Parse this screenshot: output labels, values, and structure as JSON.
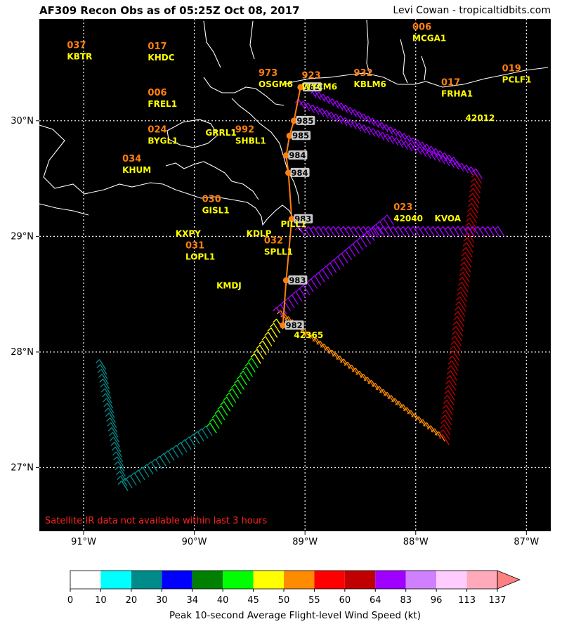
{
  "header": {
    "title": "AF309 Recon Obs as of 05:25Z Oct 08, 2017",
    "credit": "Levi Cowan - tropicaltidbits.com"
  },
  "map": {
    "extent": {
      "lon": [
        -91.4,
        -86.78
      ],
      "lat": [
        26.45,
        30.88
      ]
    },
    "lon_ticks": [
      {
        "value": -91,
        "label": "91°W"
      },
      {
        "value": -90,
        "label": "90°W"
      },
      {
        "value": -89,
        "label": "89°W"
      },
      {
        "value": -88,
        "label": "88°W"
      },
      {
        "value": -87,
        "label": "87°W"
      }
    ],
    "lat_ticks": [
      {
        "value": 27,
        "label": "27°N"
      },
      {
        "value": 28,
        "label": "28°N"
      },
      {
        "value": 29,
        "label": "29°N"
      },
      {
        "value": 30,
        "label": "30°N"
      }
    ],
    "background": "#000000",
    "grid": true,
    "note": "Satellite IR data not available within last 3 hours",
    "stations": [
      {
        "id": "KBTR",
        "value": "037",
        "lon": -91.15,
        "lat": 30.53
      },
      {
        "id": "KHDC",
        "value": "017",
        "lon": -90.42,
        "lat": 30.52
      },
      {
        "id": "FREL1",
        "value": "006",
        "lon": -90.42,
        "lat": 30.12
      },
      {
        "id": "GRRL1",
        "value": "",
        "lon": -89.9,
        "lat": 29.87
      },
      {
        "id": "BYGL1",
        "value": "024",
        "lon": -90.42,
        "lat": 29.8
      },
      {
        "id": "KHUM",
        "value": "034",
        "lon": -90.65,
        "lat": 29.55
      },
      {
        "id": "OSGM6",
        "value": "973",
        "lon": -89.42,
        "lat": 30.29
      },
      {
        "id": "WYCM6",
        "value": "923",
        "lon": -89.03,
        "lat": 30.27
      },
      {
        "id": "KBLM6",
        "value": "932",
        "lon": -88.56,
        "lat": 30.29
      },
      {
        "id": "MCGA1",
        "value": "006",
        "lon": -88.03,
        "lat": 30.69
      },
      {
        "id": "PCLF1",
        "value": "019",
        "lon": -87.22,
        "lat": 30.33
      },
      {
        "id": "FRHA1",
        "value": "017",
        "lon": -87.77,
        "lat": 30.21
      },
      {
        "id": "42012",
        "value": "",
        "lon": -87.55,
        "lat": 30.0
      },
      {
        "id": "SHBL1",
        "value": "992",
        "lon": -89.63,
        "lat": 29.8
      },
      {
        "id": "GISL1",
        "value": "030",
        "lon": -89.93,
        "lat": 29.2
      },
      {
        "id": "PILL1",
        "value": "",
        "lon": -89.22,
        "lat": 29.08
      },
      {
        "id": "KXPY",
        "value": "",
        "lon": -90.17,
        "lat": 29.0
      },
      {
        "id": "KDLP",
        "value": "",
        "lon": -89.53,
        "lat": 29.0
      },
      {
        "id": "LOPL1",
        "value": "031",
        "lon": -90.08,
        "lat": 28.8
      },
      {
        "id": "SPLL1",
        "value": "032",
        "lon": -89.37,
        "lat": 28.84
      },
      {
        "id": "KMDJ",
        "value": "",
        "lon": -89.8,
        "lat": 28.55
      },
      {
        "id": "42040",
        "value": "023",
        "lon": -88.2,
        "lat": 29.13
      },
      {
        "id": "KVOA",
        "value": "",
        "lon": -87.83,
        "lat": 29.13
      },
      {
        "id": "42365",
        "value": "",
        "lon": -89.1,
        "lat": 28.12
      }
    ],
    "center_fixes": [
      {
        "pressure": "985",
        "lon": -89.04,
        "lat": 30.29
      },
      {
        "pressure": "985",
        "lon": -89.1,
        "lat": 30.0
      },
      {
        "pressure": "985",
        "lon": -89.14,
        "lat": 29.87
      },
      {
        "pressure": "984",
        "lon": -89.17,
        "lat": 29.7
      },
      {
        "pressure": "984",
        "lon": -89.15,
        "lat": 29.55
      },
      {
        "pressure": "983",
        "lon": -89.12,
        "lat": 29.15
      },
      {
        "pressure": "983",
        "lon": -89.17,
        "lat": 28.62
      },
      {
        "pressure": "982",
        "lon": -89.2,
        "lat": 28.23
      }
    ],
    "track_color": "#ff7f0e"
  },
  "colorbar": {
    "title": "Peak 10-second Average Flight-level Wind Speed (kt)",
    "ticks": [
      "0",
      "10",
      "20",
      "30",
      "34",
      "40",
      "45",
      "50",
      "55",
      "60",
      "64",
      "83",
      "96",
      "113",
      "137"
    ],
    "colors": [
      "#ffffff",
      "#00ffff",
      "#008b8b",
      "#0000ff",
      "#008000",
      "#00ff00",
      "#ffff00",
      "#ff8c00",
      "#ff0000",
      "#c00000",
      "#a000ff",
      "#d080ff",
      "#ffccff",
      "#ffaabb"
    ],
    "extend_color": "#ff8080"
  },
  "chart_data": {
    "type": "map",
    "title": "AF309 Recon Obs as of 05:25Z Oct 08, 2017",
    "flight_legs": [
      {
        "from": [
          -90.8,
          27.85
        ],
        "to": [
          -90.6,
          26.8
        ],
        "wind_kt": 20
      },
      {
        "from": [
          -90.6,
          26.8
        ],
        "to": [
          -89.8,
          27.3
        ],
        "wind_kt": 20
      },
      {
        "from": [
          -89.8,
          27.3
        ],
        "to": [
          -89.4,
          27.9
        ],
        "wind_kt": 40
      },
      {
        "from": [
          -89.4,
          27.9
        ],
        "to": [
          -89.2,
          28.2
        ],
        "wind_kt": 45
      },
      {
        "from": [
          -89.2,
          28.3
        ],
        "to": [
          -87.7,
          27.2
        ],
        "wind_kt": 50
      },
      {
        "from": [
          -87.7,
          27.2
        ],
        "to": [
          -87.4,
          29.5
        ],
        "wind_kt": 60
      },
      {
        "from": [
          -87.4,
          29.5
        ],
        "to": [
          -89.0,
          30.1
        ],
        "wind_kt": 75
      },
      {
        "from": [
          -89.0,
          29.0
        ],
        "to": [
          -87.2,
          29.0
        ],
        "wind_kt": 75
      },
      {
        "from": [
          -89.2,
          28.3
        ],
        "to": [
          -88.2,
          29.1
        ],
        "wind_kt": 75
      },
      {
        "from": [
          -88.9,
          30.2
        ],
        "to": [
          -87.6,
          29.6
        ],
        "wind_kt": 75
      }
    ]
  }
}
